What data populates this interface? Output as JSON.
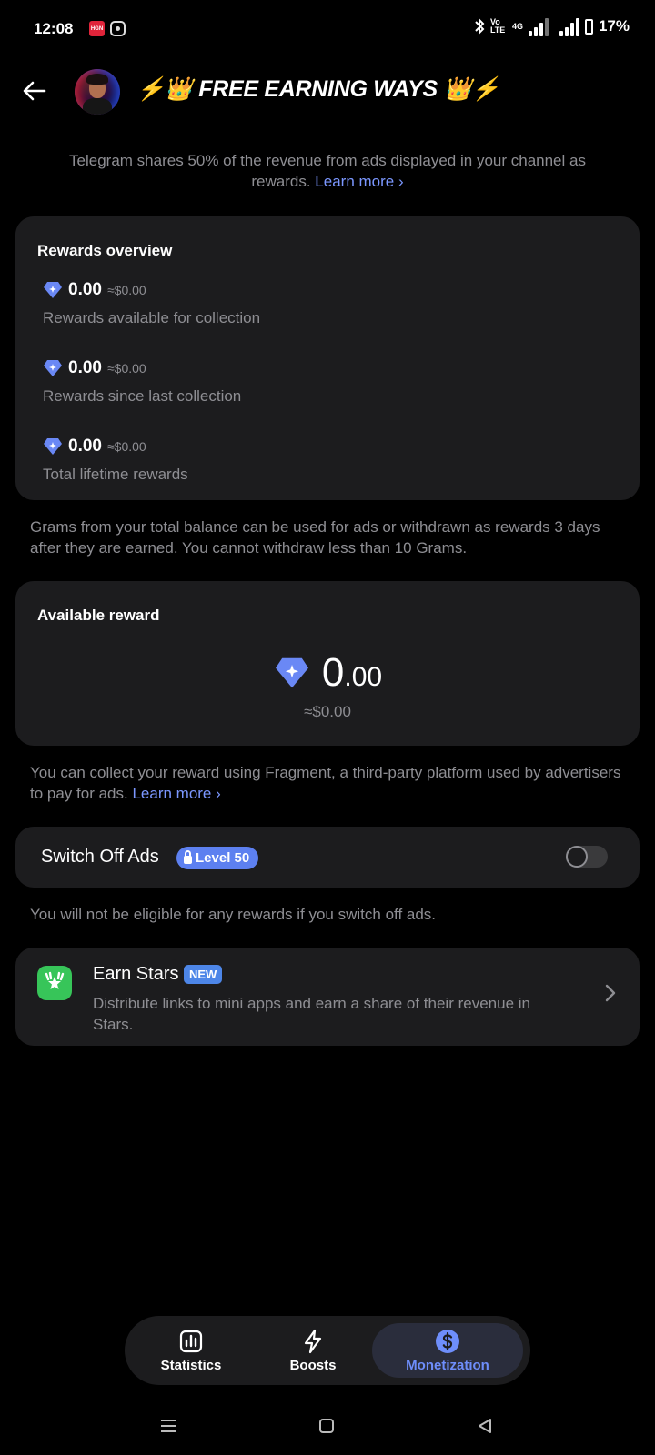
{
  "status_bar": {
    "time": "12:08",
    "app_badge_text": "HGN",
    "network_4g": "4G",
    "volte": "Vo LTE",
    "battery": "17%"
  },
  "header": {
    "title": "⚡👑 FREE EARNING WAYS 👑⚡"
  },
  "intro": {
    "text": "Telegram shares 50% of the revenue from ads displayed in your channel as rewards. ",
    "link": "Learn more ›"
  },
  "rewards_overview": {
    "title": "Rewards overview",
    "items": [
      {
        "amount": "0.00",
        "usd": "≈$0.00",
        "caption": "Rewards available for collection"
      },
      {
        "amount": "0.00",
        "usd": "≈$0.00",
        "caption": "Rewards since last collection"
      },
      {
        "amount": "0.00",
        "usd": "≈$0.00",
        "caption": "Total lifetime rewards"
      }
    ]
  },
  "grams_info": {
    "text": "Grams from your total balance can be used for ads or withdrawn as rewards 3 days after they are earned. You cannot withdraw less than 10 Grams."
  },
  "available_reward": {
    "title": "Available reward",
    "amount_int": "0",
    "amount_dec": ".00",
    "usd": "≈$0.00"
  },
  "fragment_info": {
    "text": "You can collect your reward using Fragment, a third-party platform used by advertisers to pay for ads. ",
    "link": "Learn more ›"
  },
  "switch_off_ads": {
    "label": "Switch Off Ads",
    "badge": "Level 50",
    "enabled": false
  },
  "switch_info": {
    "text": "You will not be eligible for any rewards if you switch off ads."
  },
  "earn_stars": {
    "title": "Earn Stars",
    "badge": "NEW",
    "description": "Distribute links to mini apps and earn a share of their revenue in Stars."
  },
  "tabs": [
    {
      "label": "Statistics",
      "icon": "bar-chart-icon",
      "active": false
    },
    {
      "label": "Boosts",
      "icon": "lightning-icon",
      "active": false
    },
    {
      "label": "Monetization",
      "icon": "dollar-icon",
      "active": true
    }
  ],
  "colors": {
    "accent": "#6e8efb",
    "link": "#7b97ff",
    "card": "#1c1c1e",
    "muted_text": "#8e8e93",
    "stars_green": "#37c559"
  }
}
